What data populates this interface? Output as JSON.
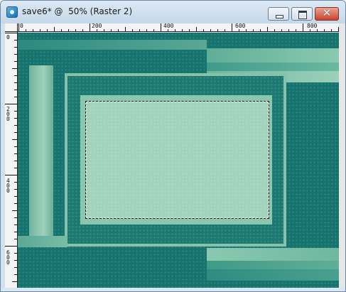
{
  "window": {
    "title": "save6* @  50% (Raster 2)",
    "close_glyph": "✕",
    "app_icon": "psp-app-icon"
  },
  "ruler": {
    "h_labels": [
      "0",
      "200",
      "400",
      "600",
      "800"
    ],
    "v_labels": [
      "0",
      "2\n0\n0",
      "4\n0\n0",
      "6\n0\n0"
    ]
  },
  "colors": {
    "canvas_base": "#17736e",
    "light_mint": "#8cc6ad",
    "selection_fill": "#a3d3bd",
    "frame": "#7fb9a4"
  }
}
